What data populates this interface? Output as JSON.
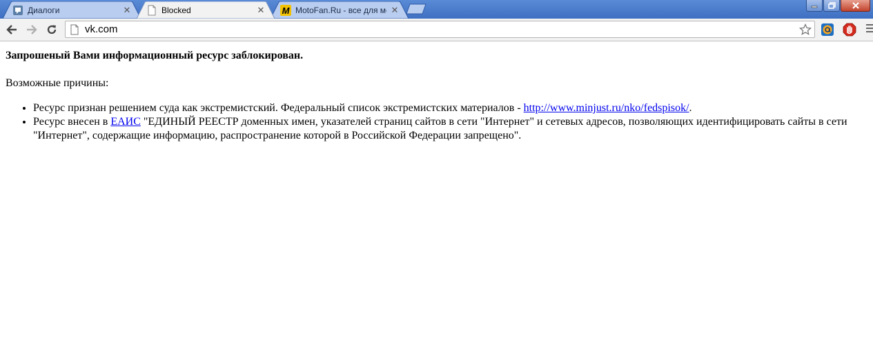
{
  "tabs": [
    {
      "title": "Диалоги",
      "state": "inactive",
      "icon": "vk-dialog-icon"
    },
    {
      "title": "Blocked",
      "state": "active",
      "icon": "page-icon"
    },
    {
      "title": "MotoFan.Ru - все для мот",
      "state": "inactive",
      "icon": "motofan-icon"
    }
  ],
  "toolbar": {
    "address": "vk.com"
  },
  "colors": {
    "tabstrip": "#4a7bcc",
    "link": "#0000ee",
    "motofan_yellow": "#f2c200"
  },
  "page": {
    "heading": "Запрошеный Вами информационный ресурс заблокирован.",
    "reasons_label": "Возможные причины:",
    "reason1": {
      "text_before": "Ресурс признан решением суда как экстремистский. Федеральный список экстремистских материалов - ",
      "link": "http://www.minjust.ru/nko/fedspisok/",
      "text_after": "."
    },
    "reason2": {
      "text_before": "Ресурс внесен в ",
      "link": "ЕАИС",
      "text_after": " \"ЕДИНЫЙ РЕЕСТР доменных имен, указателей страниц сайтов в сети \"Интернет\" и сетевых адресов, позволяющих идентифицировать сайты в сети \"Интернет\", содержащие информацию, распространение которой в Российской Федерации запрещено\"."
    }
  }
}
